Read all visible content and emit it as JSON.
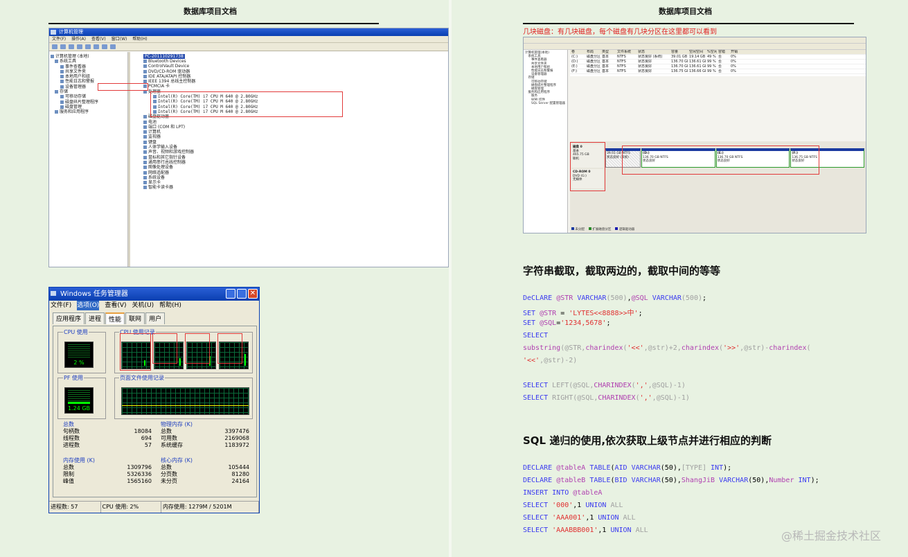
{
  "doc_title": "数据库项目文档",
  "left": {
    "computer_mgmt": {
      "title": "计算机管理",
      "menu": [
        "文件(F)",
        "操作(A)",
        "查看(V)",
        "窗口(W)",
        "帮助(H)"
      ],
      "tree": [
        "计算机管理 (本地)",
        "系统工具",
        "事件查看器",
        "共享文件夹",
        "本地用户和组",
        "性能日志和警报",
        "设备管理器",
        "存储",
        "可移动存储",
        "磁盘碎片整理程序",
        "磁盘管理",
        "服务和应用程序"
      ],
      "device_root": "PC-201110291738",
      "devices_top": [
        "Bluetooth Devices",
        "ControlVault Device",
        "DVD/CD-ROM 驱动器",
        "IDE ATA/ATAPI 控制器",
        "IEEE 1394 总线主控制器",
        "PCMCIA 卡"
      ],
      "processor_group": "处理器",
      "processors": [
        "Intel(R) Core(TM) i7 CPU         M 640  @ 2.80GHz",
        "Intel(R) Core(TM) i7 CPU         M 640  @ 2.80GHz",
        "Intel(R) Core(TM) i7 CPU         M 640  @ 2.80GHz",
        "Intel(R) Core(TM) i7 CPU         M 640  @ 2.80GHz"
      ],
      "devices_bottom": [
        "磁盘驱动器",
        "电池",
        "端口 (COM 和 LPT)",
        "计算机",
        "监视器",
        "键盘",
        "人体学输入设备",
        "声音、视频和游戏控制器",
        "鼠标和其它指针设备",
        "通用串行总线控制器",
        "图像处理设备",
        "网络适配器",
        "系统设备",
        "显示卡",
        "智能卡读卡器"
      ]
    },
    "task_manager": {
      "title": "Windows 任务管理器",
      "menu": [
        "文件(F)",
        "选项(O)",
        "查看(V)",
        "关机(U)",
        "帮助(H)"
      ],
      "tabs": [
        "应用程序",
        "进程",
        "性能",
        "联网",
        "用户"
      ],
      "cpu_usage_label": "CPU 使用",
      "cpu_usage_value": "2 %",
      "cpu_history_label": "CPU 使用记录",
      "pf_usage_label": "PF 使用",
      "pf_usage_value": "1.24 GB",
      "pf_history_label": "页面文件使用记录",
      "totals": {
        "label": "总数",
        "rows": [
          [
            "句柄数",
            "18084"
          ],
          [
            "线程数",
            "694"
          ],
          [
            "进程数",
            "57"
          ]
        ]
      },
      "physical_memory": {
        "label": "物理内存 (K)",
        "rows": [
          [
            "总数",
            "3397476"
          ],
          [
            "可用数",
            "2169068"
          ],
          [
            "系统缓存",
            "1183972"
          ]
        ]
      },
      "commit_charge": {
        "label": "内存使用 (K)",
        "rows": [
          [
            "总数",
            "1309796"
          ],
          [
            "限制",
            "5326336"
          ],
          [
            "峰值",
            "1565160"
          ]
        ]
      },
      "kernel_memory": {
        "label": "核心内存 (K)",
        "rows": [
          [
            "总数",
            "105444"
          ],
          [
            "分页数",
            "81280"
          ],
          [
            "未分页",
            "24164"
          ]
        ]
      },
      "status": [
        "进程数: 57",
        "CPU 使用: 2%",
        "内存使用: 1279M / 5201M"
      ]
    }
  },
  "right": {
    "disk_caption": "几块磁盘：有几块磁盘，每个磁盘有几块分区在这里都可以看到",
    "disk_mgmt": {
      "disk0_label": "磁盘 0",
      "disk0_info": [
        "基本",
        "465.75 GB",
        "联机"
      ],
      "cdrom_label": "CD-ROM 0",
      "cdrom_info": [
        "DVD (G:)",
        "",
        "无媒体"
      ],
      "partitions": [
        {
          "name": "",
          "size": "39.01 GB NTFS",
          "status": "状态良好 (系统)"
        },
        {
          "name": "(D:)",
          "size": "136.70 GB NTFS",
          "status": "状态良好"
        },
        {
          "name": "(E:)",
          "size": "136.70 GB NTFS",
          "status": "状态良好"
        },
        {
          "name": "(F:)",
          "size": "136.75 GB NTFS",
          "status": "状态良好"
        }
      ]
    },
    "section1_title": "字符串截取，截取两边的，截取中间的等等",
    "section2_title": "SQL 递归的使用,依次获取上级节点并进行相应的判断",
    "watermark": "@稀土掘金技术社区"
  }
}
